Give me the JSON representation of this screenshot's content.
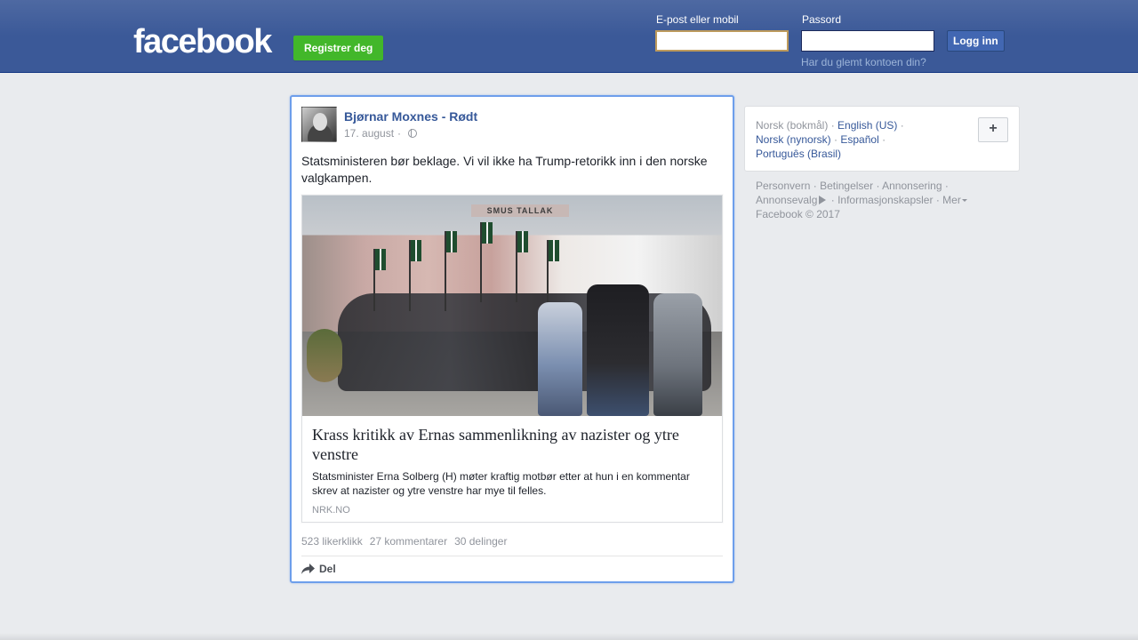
{
  "header": {
    "logo": "facebook",
    "register_label": "Registrer deg",
    "email_label": "E-post eller mobil",
    "email_value": "",
    "password_label": "Passord",
    "password_value": "",
    "login_label": "Logg inn",
    "forgot_label": "Har du glemt kontoen din?"
  },
  "post": {
    "author": "Bjørnar Moxnes - Rødt",
    "date": "17. august",
    "meta_sep": "·",
    "status_text": "Statsministeren bør beklage. Vi vil ikke ha Trump-retorikk inn i den norske valgkampen.",
    "link": {
      "image_sign": "SMUS TALLAK",
      "title": "Krass kritikk av Ernas sammenlikning av nazister og ytre venstre",
      "description": "Statsminister Erna Solberg (H) møter kraftig motbør etter at hun i en kommentar skrev at nazister og ytre venstre har mye til felles.",
      "domain": "NRK.NO"
    },
    "stats": {
      "likes": "523 likerklikk",
      "comments": "27 kommentarer",
      "shares": "30 delinger"
    },
    "share_label": "Del"
  },
  "languages": {
    "current": "Norsk (bokmål)",
    "items": [
      "English (US)",
      "Norsk (nynorsk)",
      "Español",
      "Português (Brasil)"
    ],
    "add_label": "+",
    "sep": "·"
  },
  "footer": {
    "links": [
      "Personvern",
      "Betingelser",
      "Annonsering",
      "Annonsevalg",
      "Informasjonskapsler",
      "Mer"
    ],
    "copyright": "Facebook © 2017"
  },
  "colors": {
    "brand_blue": "#3b5998",
    "link_blue": "#365899",
    "register_green": "#42b72a",
    "focus_border": "#6d9eeb"
  }
}
